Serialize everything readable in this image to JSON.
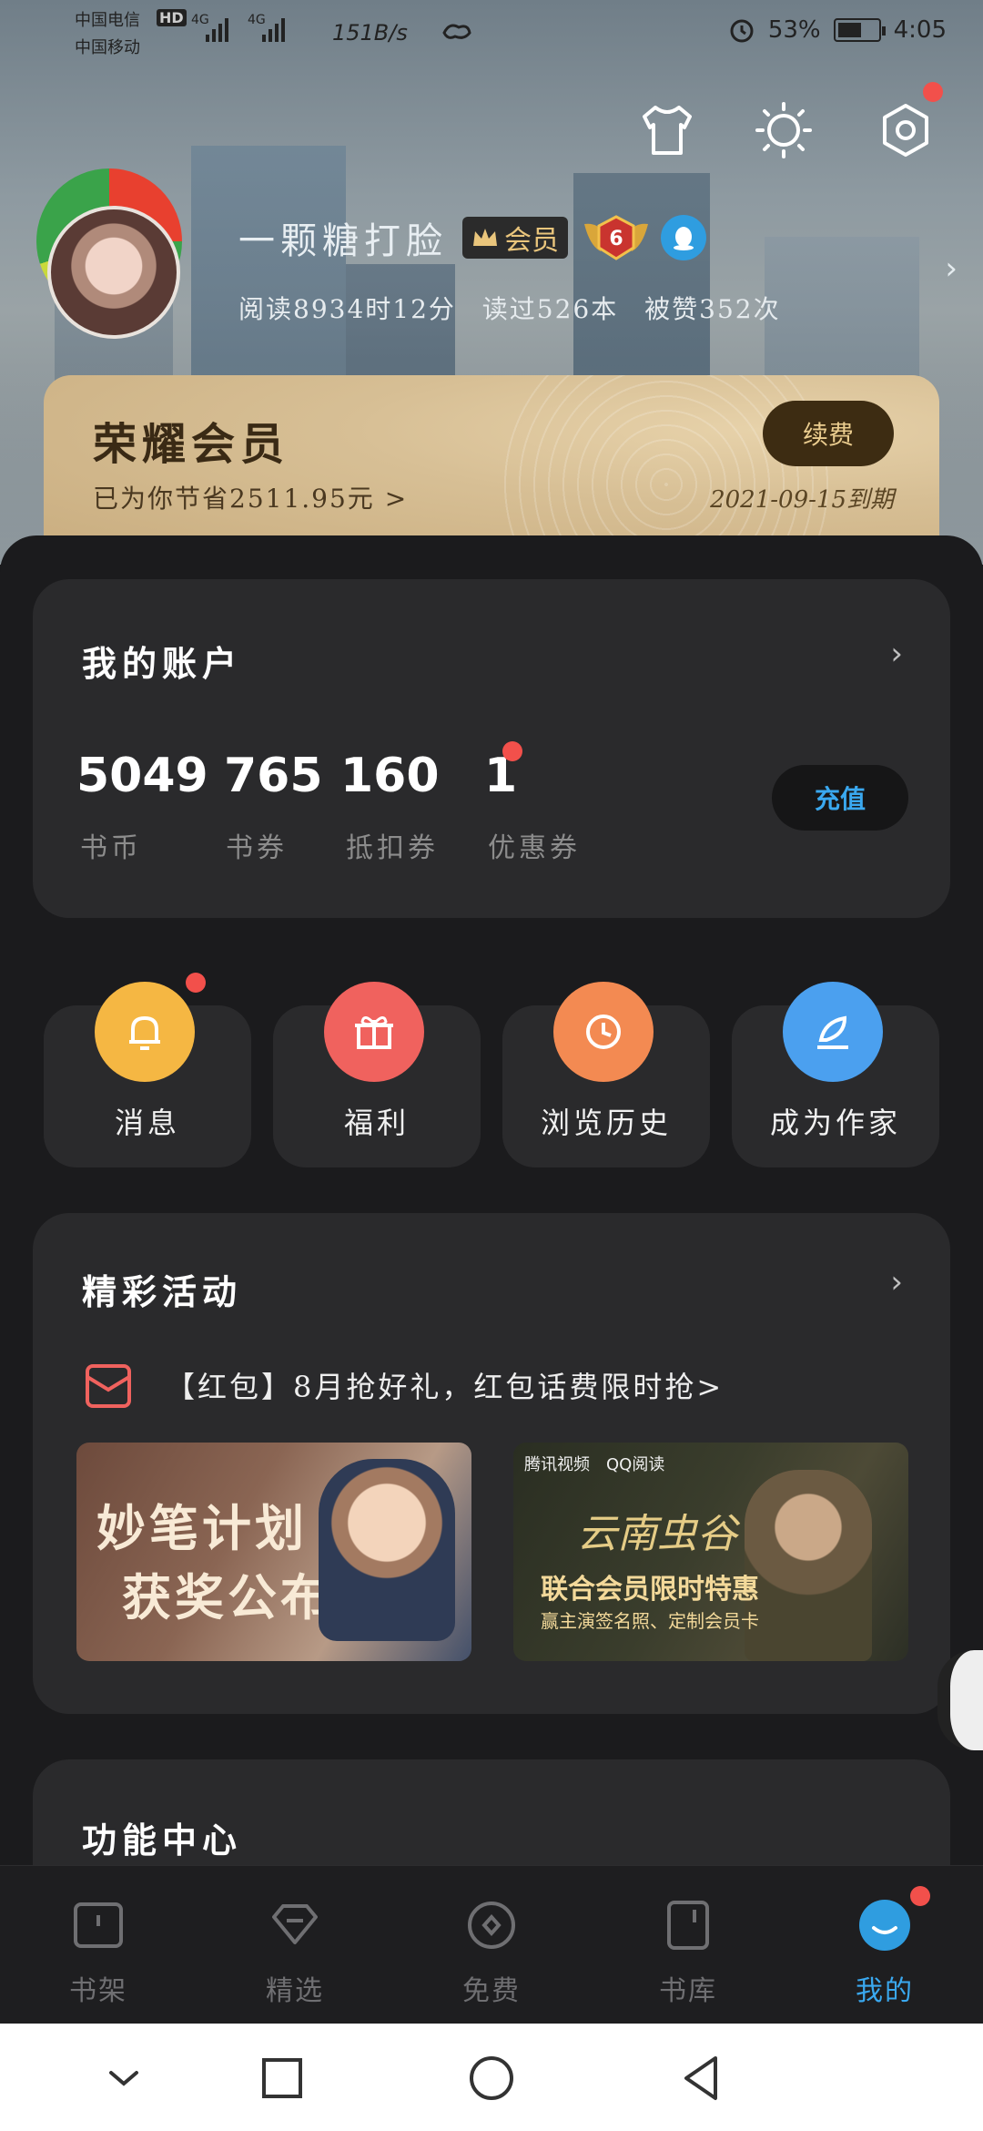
{
  "status_bar": {
    "carrier1": "中国电信",
    "carrier2": "中国移动",
    "hd": "HD",
    "net1": "4G",
    "net2": "4G",
    "speed": "151B/s",
    "battery": "53%",
    "time": "4:05"
  },
  "profile": {
    "nickname": "一颗糖打脸",
    "vip_label": "会员",
    "level": "6",
    "stats": "阅读8934时12分   读过526本   被赞352次"
  },
  "vip_card": {
    "title": "荣耀会员",
    "savings": "已为你节省2511.95元 >",
    "renew_label": "续费",
    "expire": "2021-09-15到期"
  },
  "account": {
    "title": "我的账户",
    "recharge_label": "充值",
    "items": [
      {
        "value": "5049",
        "label": "书币"
      },
      {
        "value": "765",
        "label": "书券"
      },
      {
        "value": "160",
        "label": "抵扣券"
      },
      {
        "value": "1",
        "label": "优惠券"
      }
    ]
  },
  "quick_actions": [
    {
      "label": "消息",
      "icon": "bell-icon",
      "color": "#f5b743"
    },
    {
      "label": "福利",
      "icon": "gift-icon",
      "color": "#f0625e"
    },
    {
      "label": "浏览历史",
      "icon": "clock-icon",
      "color": "#f38a52"
    },
    {
      "label": "成为作家",
      "icon": "pen-icon",
      "color": "#4ba0ef"
    }
  ],
  "activities": {
    "title": "精彩活动",
    "promo_text": "【红包】8月抢好礼，红包话费限时抢>",
    "banner1_line1": "妙笔计划",
    "banner1_line2": "获奖公布",
    "banner2_brand1": "腾讯视频",
    "banner2_brand2": "QQ阅读",
    "banner2_title": "云南虫谷",
    "banner2_line1": "联合会员限时特惠",
    "banner2_line2": "赢主演签名照、定制会员卡"
  },
  "function_center": {
    "title": "功能中心"
  },
  "tabs": [
    {
      "label": "书架"
    },
    {
      "label": "精选"
    },
    {
      "label": "免费"
    },
    {
      "label": "书库"
    },
    {
      "label": "我的"
    }
  ],
  "colors": {
    "accent": "#3aa8ef",
    "badge": "#f2504b",
    "vip_gold": "#d7bf95"
  }
}
